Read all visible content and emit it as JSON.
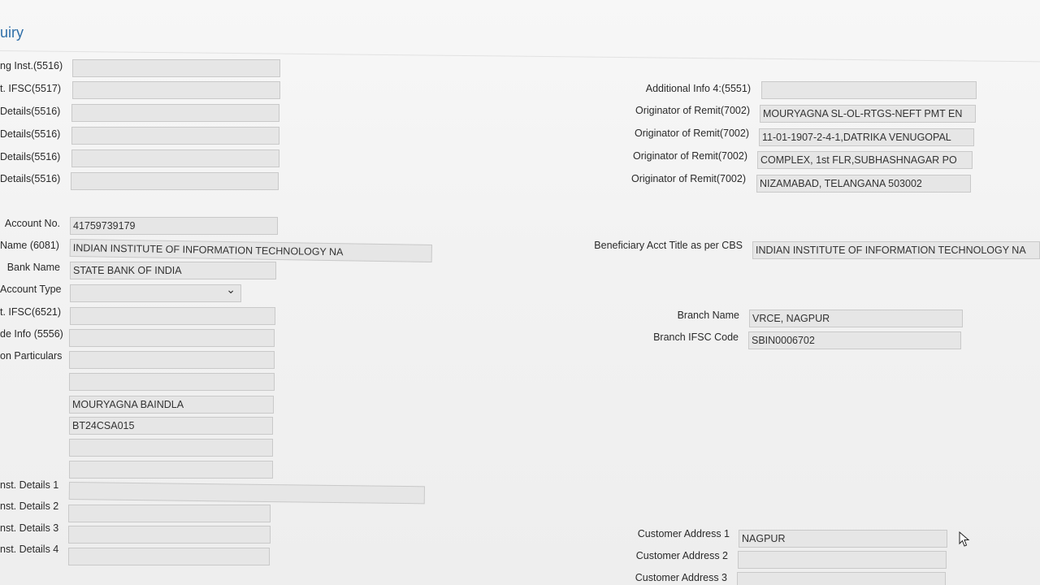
{
  "page": {
    "title": "uiry"
  },
  "left": {
    "labels": {
      "sending_inst": "ng Inst.(5516)",
      "ifsc_5517": "t. IFSC(5517)",
      "details_1": "Details(5516)",
      "details_2": "Details(5516)",
      "details_3": "Details(5516)",
      "details_4": "Details(5516)",
      "account_no": "Account No.",
      "name_6081": "Name (6081)",
      "bank_name": "Bank Name",
      "account_type": "Account Type",
      "ifsc_6521": "t. IFSC(6521)",
      "code_info": "de Info (5556)",
      "particulars": "on Particulars",
      "inst_details_1": "nst. Details 1",
      "inst_details_2": "nst. Details 2",
      "inst_details_3": "nst. Details 3",
      "inst_details_4": "nst. Details 4"
    },
    "values": {
      "sending_inst": "",
      "ifsc_5517": "",
      "details_1": "",
      "details_2": "",
      "details_3": "",
      "details_4": "",
      "account_no": "41759739179",
      "name_6081": "INDIAN INSTITUTE OF INFORMATION TECHNOLOGY NA",
      "bank_name": "STATE BANK OF INDIA",
      "account_type": "",
      "ifsc_6521": "",
      "code_info": "",
      "particulars_1": "",
      "particulars_2": "",
      "particulars_3": "MOURYAGNA BAINDLA",
      "particulars_4": "BT24CSA015",
      "particulars_5": "",
      "particulars_6": "",
      "inst_details_1": "",
      "inst_details_2": "",
      "inst_details_3": "",
      "inst_details_4": ""
    }
  },
  "right": {
    "labels": {
      "additional_info_4": "Additional Info 4:(5551)",
      "originator_1": "Originator of Remit(7002)",
      "originator_2": "Originator of Remit(7002)",
      "originator_3": "Originator of Remit(7002)",
      "originator_4": "Originator of Remit(7002)",
      "beneficiary_title": "Beneficiary Acct Title as per CBS",
      "branch_name": "Branch Name",
      "branch_ifsc": "Branch IFSC Code",
      "customer_address_1": "Customer Address 1",
      "customer_address_2": "Customer Address 2",
      "customer_address_3": "Customer Address 3"
    },
    "values": {
      "additional_info_4": "",
      "originator_1": "MOURYAGNA SL-OL-RTGS-NEFT PMT EN",
      "originator_2": "11-01-1907-2-4-1,DATRIKA VENUGOPAL",
      "originator_3": "COMPLEX, 1st FLR,SUBHASHNAGAR PO",
      "originator_4": "NIZAMABAD, TELANGANA 503002",
      "beneficiary_title": "INDIAN INSTITUTE OF INFORMATION TECHNOLOGY NA",
      "branch_name": "VRCE, NAGPUR",
      "branch_ifsc": "SBIN0006702",
      "customer_address_1": "NAGPUR",
      "customer_address_2": "",
      "customer_address_3": ""
    }
  }
}
